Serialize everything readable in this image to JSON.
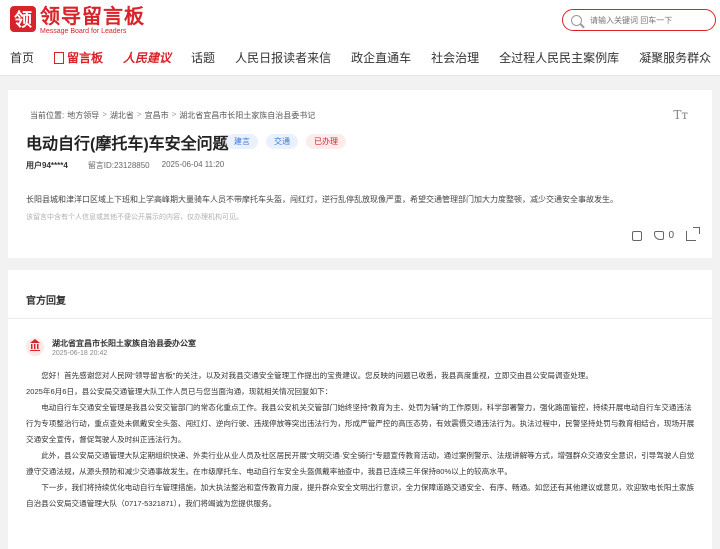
{
  "header": {
    "logo_mark": "领",
    "logo_title": "领导留言板",
    "logo_subtitle": "Message Board for Leaders",
    "search_placeholder": "请输入关键词 回车一下"
  },
  "nav": {
    "items": [
      "首页",
      "留言板",
      "人民建议",
      "话题",
      "人民日报读者来信",
      "政企直通车",
      "社会治理",
      "全过程人民民主案例库",
      "凝聚服务群众"
    ]
  },
  "question": {
    "breadcrumb": [
      "当前位置:",
      "地方领导",
      "湖北省",
      "宜昌市",
      "湖北省宜昌市长阳土家族自治县委书记"
    ],
    "breadcrumb_sep": ">",
    "font_icon": "Tт",
    "title": "电动自行(摩托车)车安全问题",
    "tags": [
      "建言",
      "交通",
      "已办理"
    ],
    "user": "用户94****4",
    "message_id": "留言ID:23128850",
    "time": "2025-06-04 11:20",
    "body": "长阳县城和津洋口区域上下班和上学高峰期大量骑车人员不带摩托车头盔，闯红灯，逆行乱停乱放现像严重，希望交通管理部门加大力度整顿，减少交通安全事故发生。",
    "disclaimer": "该留言中含有个人信息或其他不便公开展示的内容，仅办理机构可见。",
    "like_count": "0"
  },
  "reply": {
    "section_title": "官方回复",
    "org_name": "湖北省宜昌市长阳土家族自治县委办公室",
    "org_time": "2025-06-18 20:42",
    "paragraphs": [
      "您好！首先感谢您对人民网“领导留言板”的关注，以及对我县交通安全管理工作提出的宝贵建议。您反映的问题已收悉，我县高度重视，立即交由县公安局调查处理。",
      "2025年6月6日，县公安局交通管理大队工作人员已与您当面沟通，现就相关情况回复如下：",
      "电动自行车交通安全管理是我县公安交管部门的常态化重点工作。我县公安机关交管部门始终坚持“教育为主、处罚为辅”的工作原则，科学部署警力，强化路面管控，持续开展电动自行车交通违法行为专项整治行动，重点查处未佩戴安全头盔、闯红灯、逆向行驶、违规停放等突出违法行为，形成严管严控的高压态势，有效震慑交通违法行为。执法过程中，民警坚持处罚与教育相结合，现场开展交通安全宣传，督促驾驶人及时纠正违法行为。",
      "此外，县公安局交通管理大队定期组织快递、外卖行业从业人员及社区居民开展“文明交通·安全骑行”专题宣传教育活动，通过案例警示、法规讲解等方式，增强群众交通安全意识，引导驾驶人自觉遵守交通法规，从源头预防和减少交通事故发生。在市级摩托车、电动自行车安全头盔佩戴率抽查中，我县已连续三年保持80%以上的较高水平。",
      "下一步，我们将持续优化电动自行车管理措施，加大执法整治和宣传教育力度，提升群众安全文明出行意识，全力保障道路交通安全、有序、畅通。如您还有其他建议或意见，欢迎致电长阳土家族自治县公安局交通管理大队（0717-5321871），我们将竭诚为您提供服务。"
    ]
  },
  "colors": {
    "accent": "#d8232a",
    "tag_blue": "#3a78d8"
  }
}
